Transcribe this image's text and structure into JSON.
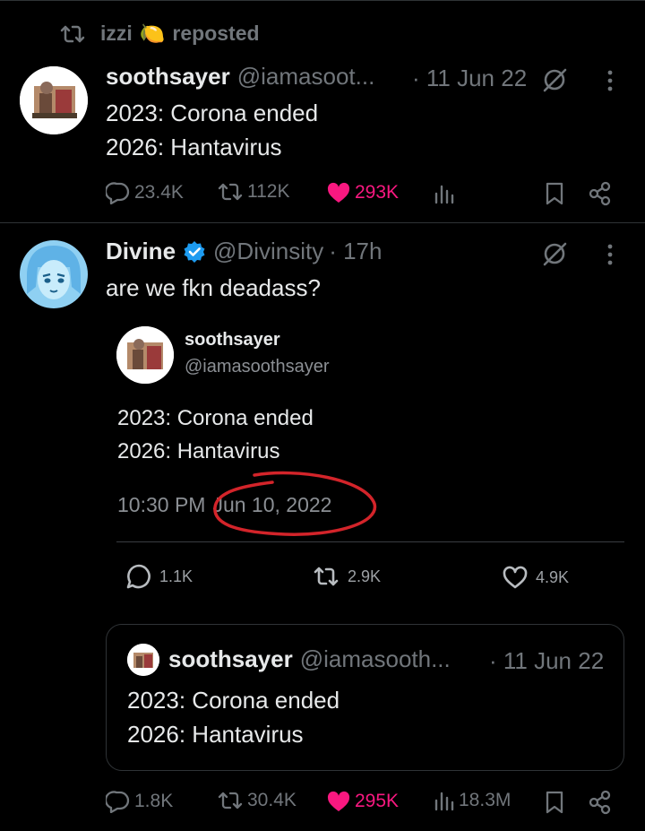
{
  "repost_header": {
    "user": "izzi",
    "emoji": "🍋",
    "label": "reposted"
  },
  "post1": {
    "name": "soothsayer",
    "handle": "@iamasoot...",
    "time": "· 11 Jun 22",
    "line1": "2023: Corona ended",
    "line2": "2026: Hantavirus",
    "replies": "23.4K",
    "reposts": "112K",
    "likes": "293K"
  },
  "post2": {
    "name": "Divine",
    "handle": "@Divinsity",
    "time": "· 17h",
    "text": "are we fkn deadass?",
    "screenshot": {
      "name": "soothsayer",
      "handle": "@iamasoothsayer",
      "line1": "2023: Corona ended",
      "line2": "2026: Hantavirus",
      "time": "10:30 PM",
      "date": "Jun 10, 2022",
      "replies": "1.1K",
      "reposts": "2.9K",
      "likes": "4.9K"
    },
    "quote": {
      "name": "soothsayer",
      "handle": "@iamasooth...",
      "time": "· 11 Jun 22",
      "line1": "2023: Corona ended",
      "line2": "2026: Hantavirus"
    },
    "replies": "1.8K",
    "reposts": "30.4K",
    "likes": "295K",
    "views": "18.3M"
  },
  "colors": {
    "background": "#000000",
    "text": "#e7e9ea",
    "muted": "#71767b",
    "like": "#f91880",
    "verified": "#1d9bf0",
    "annotation": "#d3242a"
  }
}
